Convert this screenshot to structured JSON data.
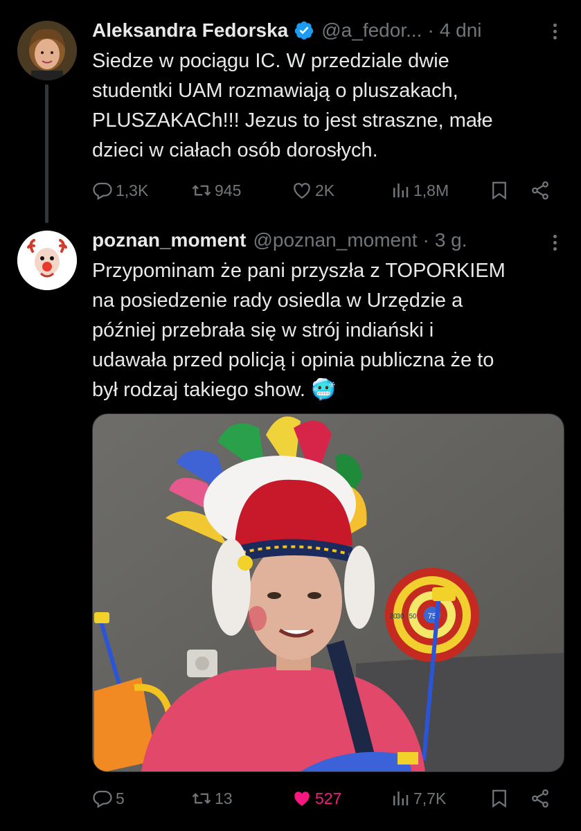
{
  "tweet1": {
    "name": "Aleksandra Fedorska",
    "handle": "@a_fedor...",
    "separator": "·",
    "time": "4 dni",
    "text": "Siedze w pociągu IC. W przedziale dwie\nstudentki UAM rozmawiają o pluszakach,\nPLUSZAKACh!!! Jezus to jest straszne, małe\ndzieci w ciałach osób dorosłych.",
    "replies": "1,3K",
    "retweets": "945",
    "likes": "2K",
    "views": "1,8M"
  },
  "tweet2": {
    "name": "poznan_moment",
    "handle": "@poznan_moment",
    "separator": "·",
    "time": "3 g.",
    "text": "Przypominam że pani przyszła z TOPORKIEM\nna posiedzenie rady osiedla w Urzędzie a\npóźniej przebrała się w strój indiański i\nudawała przed policją i opinia publiczna że to\nbył rodzaj takiego show. 🥶",
    "replies": "5",
    "retweets": "13",
    "likes": "527",
    "views": "7,7K",
    "liked": true
  },
  "colors": {
    "background": "#000000",
    "text": "#e7e9ea",
    "muted": "#71767b",
    "verified": "#1d9bf0",
    "like": "#f91880"
  },
  "icons": [
    "reply-icon",
    "retweet-icon",
    "like-icon",
    "views-icon",
    "bookmark-icon",
    "share-icon",
    "verified-badge-icon",
    "more-icon"
  ],
  "target": {
    "labels": [
      "20",
      "30",
      "50",
      "75"
    ]
  }
}
